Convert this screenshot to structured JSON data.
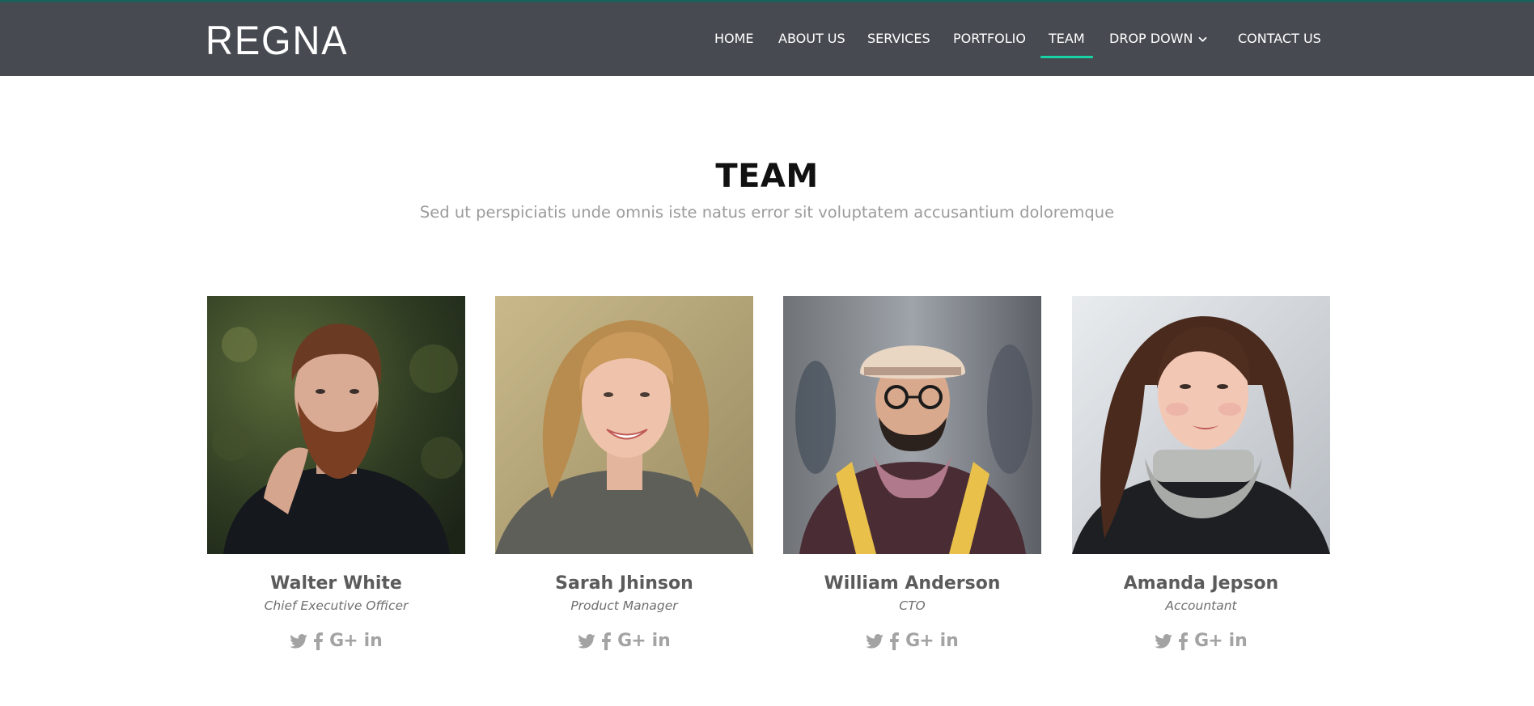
{
  "header": {
    "logo": "REGNA",
    "nav": [
      {
        "label": "HOME"
      },
      {
        "label": "ABOUT US"
      },
      {
        "label": "SERVICES"
      },
      {
        "label": "PORTFOLIO"
      },
      {
        "label": "TEAM",
        "active": true
      },
      {
        "label": "DROP DOWN",
        "has_dropdown": true
      },
      {
        "label": "CONTACT US"
      }
    ],
    "colors": {
      "background": "#474b51",
      "top_border": "#1c5f5b",
      "active_underline": "#18d3a3"
    }
  },
  "section": {
    "title": "TEAM",
    "subtitle": "Sed ut perspiciatis unde omnis iste natus error sit voluptatem accusantium doloremque"
  },
  "team": [
    {
      "name": "Walter White",
      "role": "Chief Executive Officer",
      "photo": "portrait-bearded-man-dark-sweater"
    },
    {
      "name": "Sarah Jhinson",
      "role": "Product Manager",
      "photo": "portrait-smiling-blonde-woman"
    },
    {
      "name": "William Anderson",
      "role": "CTO",
      "photo": "portrait-man-hat-glasses-scarf"
    },
    {
      "name": "Amanda Jepson",
      "role": "Accountant",
      "photo": "portrait-woman-grey-turtleneck"
    }
  ],
  "social_icons": [
    "twitter-icon",
    "facebook-icon",
    "google-plus-icon",
    "linkedin-icon"
  ],
  "social_text": {
    "google_plus": "G+",
    "linkedin": "in"
  }
}
